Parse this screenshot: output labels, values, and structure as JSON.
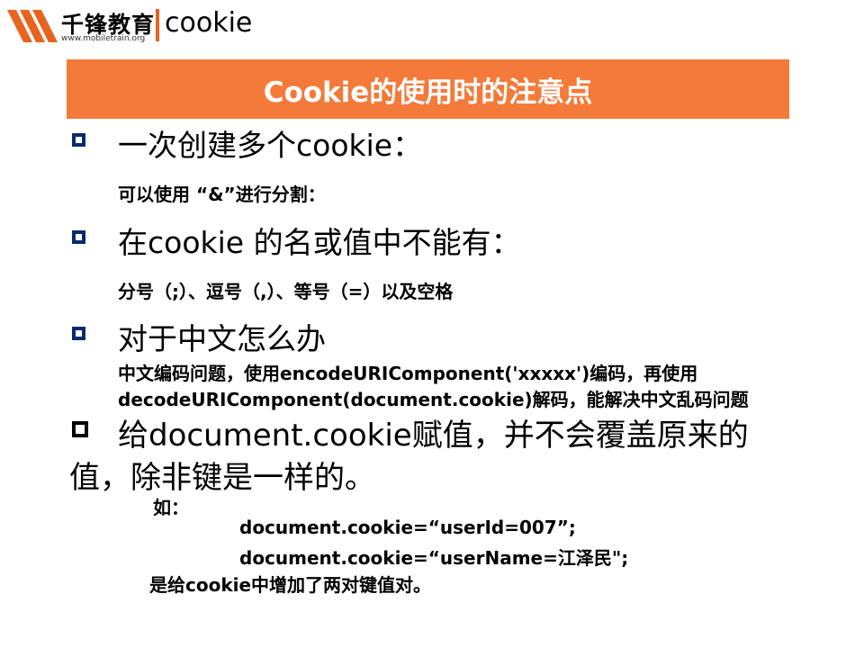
{
  "header": {
    "logo_text": "千锋教育",
    "logo_url": "www.mobiletrain.org",
    "title": "cookie"
  },
  "banner": {
    "title": "Cookie的使用时的注意点"
  },
  "bullets": [
    {
      "heading": "一次创建多个cookie：",
      "details": [
        "可以使用 “&”进行分割："
      ]
    },
    {
      "heading": "在cookie 的名或值中不能有：",
      "details": [
        "分号（;）、逗号（,）、等号（=）以及空格"
      ]
    },
    {
      "heading": "对于中文怎么办",
      "details": [
        "中文编码问题，使用encodeURIComponent('xxxxx')编码，再使用",
        "decodeURIComponent(document.cookie)解码，能解决中文乱码问题"
      ]
    },
    {
      "heading_line1": "给document.cookie赋值，并不会覆盖原来的",
      "heading_line2": "值，除非键是一样的。"
    }
  ],
  "example": {
    "label": "如：",
    "code": [
      "document.cookie=“userId=007”;",
      "document.cookie=“userName=江泽民\";"
    ],
    "conclusion": "是给cookie中增加了两对键值对。"
  },
  "colors": {
    "accent": "#f47a3a",
    "bullet": "#0a2a6e"
  }
}
